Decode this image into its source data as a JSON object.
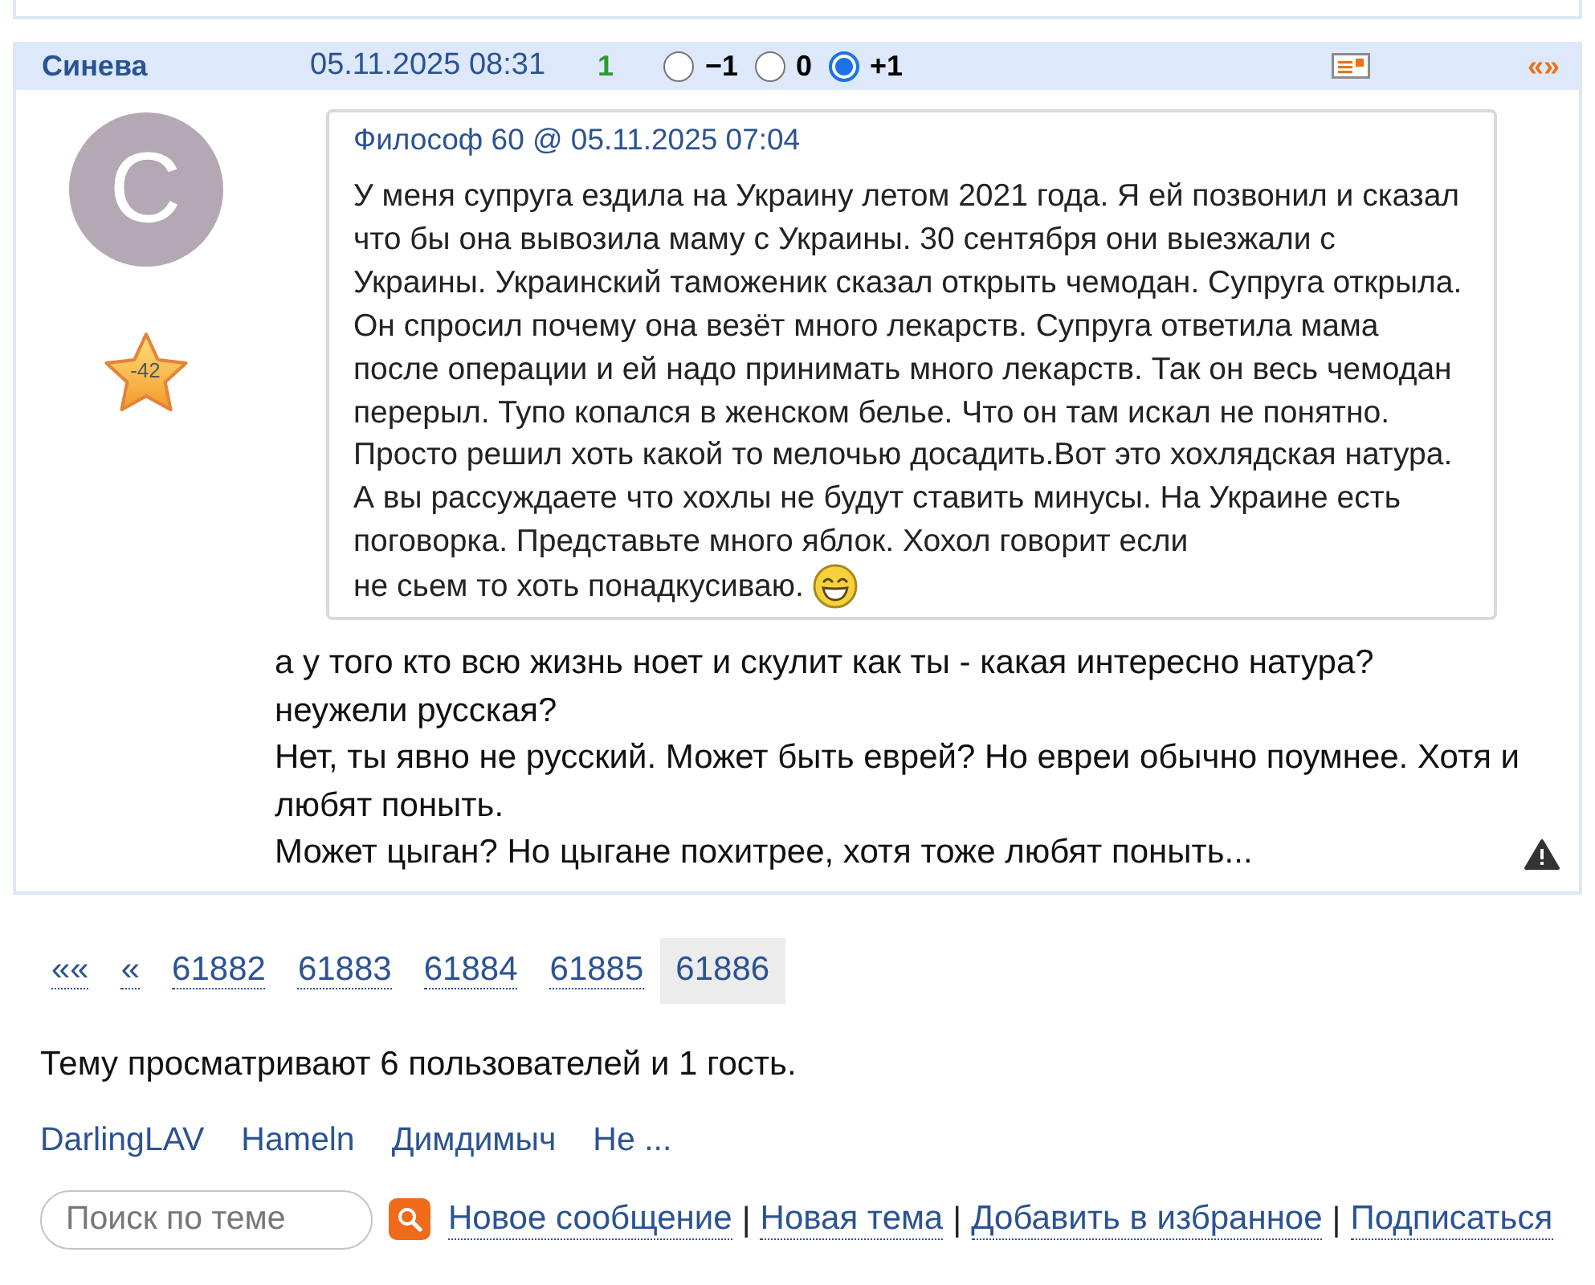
{
  "post": {
    "author": "Синева",
    "date": "05.11.2025 08:31",
    "score": "1",
    "vote_options": [
      {
        "label": "−1",
        "selected": false
      },
      {
        "label": "0",
        "selected": false
      },
      {
        "label": "+1",
        "selected": true
      }
    ],
    "nav_link": "«»",
    "avatar_letter": "С",
    "rating": "-42",
    "quote": {
      "header": "Философ 60 @ 05.11.2025 07:04",
      "text_parts": [
        "У меня супруга ездила на Украину летом 2021 года. Я ей позвонил и сказал что бы она вывозила маму с Украины. 30 сентября они выезжали с Украины. Украинский таможеник сказал открыть чемодан. Супруга открыла. Он спросил почему она везёт много лекарств. Супруга ответила мама после операции и ей надо принимать много лекарств. Так он весь чемодан перерыл. Тупо копался в женском белье. Что он там искал не понятно. Просто решил хоть какой то мелочью досадить.Вот это хохлядская натура. А вы рассуждаете что хохлы не будут ставить минусы. На Украине есть поговорка. Представьте много яблок. Хохол говорит если",
        "не сьем то хоть понадкусиваю."
      ]
    },
    "text_lines": [
      "а у того кто всю жизнь ноет и скулит как ты - какая интересно натура?",
      "неужели русская?",
      "Нет, ты явно не русский. Может быть еврей? Но евреи обычно поумнее. Хотя и любят поныть.",
      "Может цыган? Но цыгане похитрее, хотя тоже любят поныть..."
    ]
  },
  "pagination": [
    {
      "label": "««",
      "selected": false
    },
    {
      "label": "«",
      "selected": false
    },
    {
      "label": "61882",
      "selected": false
    },
    {
      "label": "61883",
      "selected": false
    },
    {
      "label": "61884",
      "selected": false
    },
    {
      "label": "61885",
      "selected": false
    },
    {
      "label": "61886",
      "selected": true
    }
  ],
  "viewers": {
    "summary": "Тему просматривают 6 пользователей и 1 гость.",
    "users": [
      "DarlingLAV",
      "Hameln",
      "Димдимыч",
      "Не ..."
    ]
  },
  "footer": {
    "search": {
      "placeholder": "Поиск по теме"
    },
    "separator": "|",
    "links": [
      "Новое сообщение",
      "Новая тема",
      "Добавить в избранное",
      "Подписаться"
    ]
  }
}
